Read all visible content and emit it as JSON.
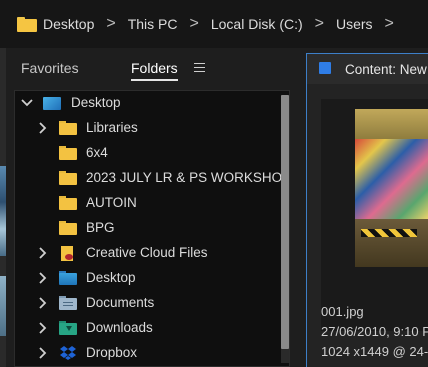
{
  "breadcrumb": {
    "items": [
      "Desktop",
      "This PC",
      "Local Disk (C:)",
      "Users",
      ""
    ],
    "separator": ">"
  },
  "left_panel": {
    "tabs": [
      "Favorites",
      "Folders"
    ],
    "active_tab": "Folders"
  },
  "tree": [
    {
      "label": "Desktop",
      "chevron": "expanded",
      "icon": "desktop-folder-icon",
      "level": 0
    },
    {
      "label": "Libraries",
      "chevron": "collapsed",
      "icon": "folder-icon",
      "level": 1
    },
    {
      "label": "6x4",
      "chevron": "none",
      "icon": "folder-icon",
      "level": 1
    },
    {
      "label": "2023 JULY LR & PS WORKSHOP",
      "chevron": "none",
      "icon": "folder-icon",
      "level": 1
    },
    {
      "label": "AUTOIN",
      "chevron": "none",
      "icon": "folder-icon",
      "level": 1
    },
    {
      "label": "BPG",
      "chevron": "none",
      "icon": "folder-icon",
      "level": 1
    },
    {
      "label": "Creative Cloud Files",
      "chevron": "collapsed",
      "icon": "creative-cloud-folder-icon",
      "level": 1
    },
    {
      "label": "Desktop",
      "chevron": "collapsed",
      "icon": "blue-folder-icon",
      "level": 1
    },
    {
      "label": "Documents",
      "chevron": "collapsed",
      "icon": "documents-folder-icon",
      "level": 1
    },
    {
      "label": "Downloads",
      "chevron": "collapsed",
      "icon": "downloads-folder-icon",
      "level": 1
    },
    {
      "label": "Dropbox",
      "chevron": "collapsed",
      "icon": "dropbox-icon",
      "level": 1
    }
  ],
  "content": {
    "title": "Content: New",
    "file_name": "001.jpg",
    "file_date": "27/06/2010, 9:10 P",
    "file_dims": "1024 x1449 @ 24-"
  },
  "colors": {
    "accent": "#3d7fc8",
    "folder": "#f3c241",
    "dropbox": "#1e63d6"
  }
}
